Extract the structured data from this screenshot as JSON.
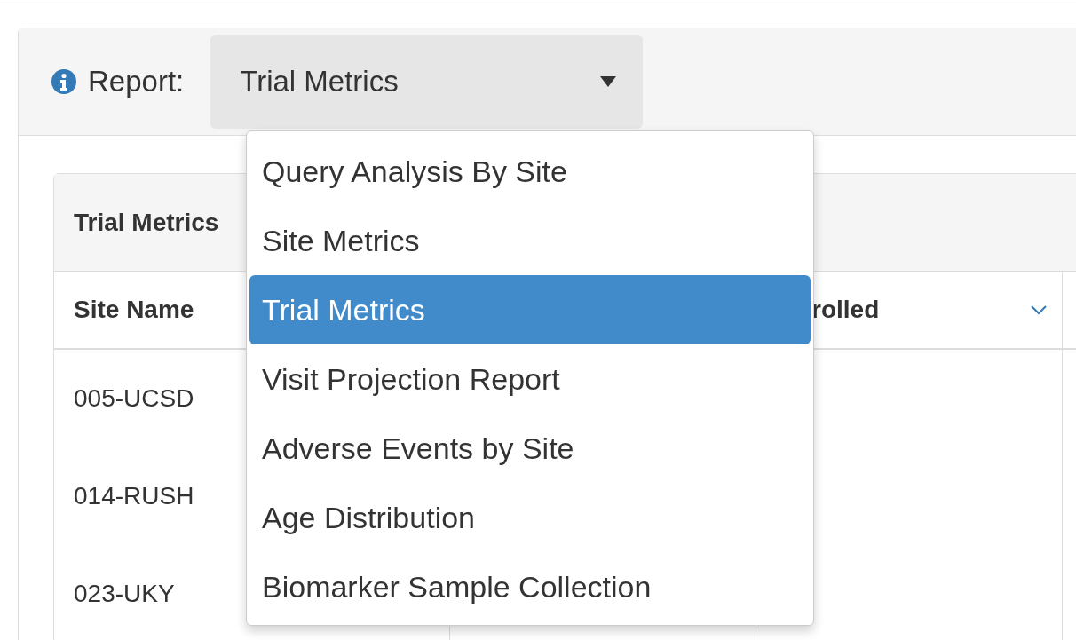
{
  "report": {
    "label": "Report:",
    "value": "Trial Metrics"
  },
  "card": {
    "title": "Trial Metrics"
  },
  "table": {
    "columns": [
      {
        "label": "Site Name"
      },
      {
        "label": "rolled",
        "sortable": true
      }
    ],
    "rows": [
      [
        "005-UCSD"
      ],
      [
        "014-RUSH"
      ],
      [
        "023-UKY"
      ]
    ]
  },
  "dropdown": {
    "items": [
      {
        "label": "Query Analysis By Site",
        "selected": false
      },
      {
        "label": "Site Metrics",
        "selected": false
      },
      {
        "label": "Trial Metrics",
        "selected": true
      },
      {
        "label": "Visit Projection Report",
        "selected": false
      },
      {
        "label": "Adverse Events by Site",
        "selected": false
      },
      {
        "label": "Age Distribution",
        "selected": false
      },
      {
        "label": "Biomarker Sample Collection",
        "selected": false
      }
    ]
  }
}
